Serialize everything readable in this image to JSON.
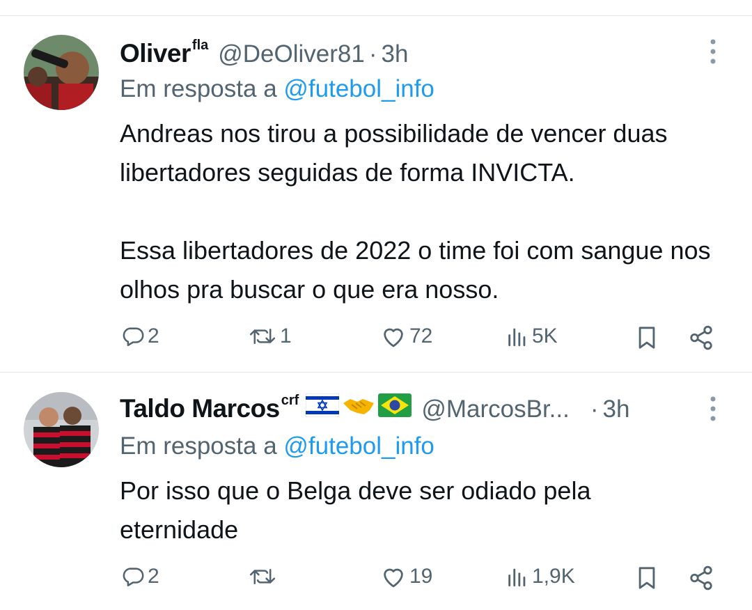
{
  "tweets": [
    {
      "name": "Oliver",
      "name_sup": "fla",
      "handle": "@DeOliver81",
      "separator": "·",
      "time": "3h",
      "reply_prefix": "Em resposta a",
      "reply_mention": "@futebol_info",
      "text_lines": [
        "Andreas nos tirou a possibilidade de vencer duas libertadores seguidas de forma INVICTA.",
        "Essa libertadores de 2022 o time foi com sangue nos olhos pra buscar o que era nosso."
      ],
      "stats": {
        "replies": "2",
        "retweets": "1",
        "likes": "72",
        "views": "5K"
      },
      "icons": [
        "reply-icon",
        "retweet-icon",
        "like-icon",
        "views-icon",
        "bookmark-icon",
        "share-icon",
        "more-icon"
      ]
    },
    {
      "name": "Taldo Marcos",
      "name_sup": "crf",
      "flags": [
        "israel-flag",
        "handshake",
        "brazil-flag"
      ],
      "handle": "@MarcosBr...",
      "separator": "·",
      "time": "3h",
      "reply_prefix": "Em resposta a",
      "reply_mention": "@futebol_info",
      "text_lines": [
        "Por isso que o Belga deve ser odiado pela eternidade"
      ],
      "stats": {
        "replies": "2",
        "retweets": "",
        "likes": "19",
        "views": "1,9K"
      },
      "icons": [
        "reply-icon",
        "retweet-icon",
        "like-icon",
        "views-icon",
        "bookmark-icon",
        "share-icon",
        "more-icon"
      ]
    }
  ],
  "colors": {
    "text": "#0f1419",
    "secondary": "#536471",
    "link": "#1d9bf0",
    "divider": "#e6e9ec"
  }
}
